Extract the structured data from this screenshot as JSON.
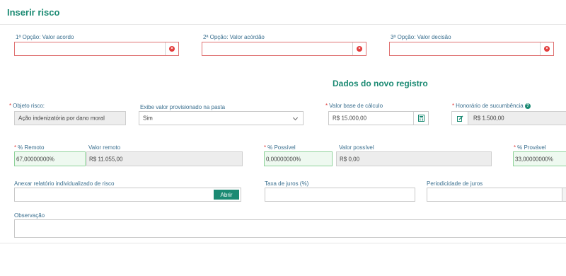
{
  "header": {
    "title": "Inserir risco"
  },
  "options": [
    {
      "label": "1ª Opção: Valor acordo",
      "value": ""
    },
    {
      "label": "2ª Opção: Valor acórdão",
      "value": ""
    },
    {
      "label": "3ª Opção: Valor decisão",
      "value": ""
    }
  ],
  "section_title": "Dados do novo registro",
  "objeto_risco": {
    "label": "Objeto risco:",
    "value": "Ação indenizatória por dano moral"
  },
  "exibe_valor": {
    "label": "Exibe valor provisionado na pasta",
    "value": "Sim"
  },
  "valor_base": {
    "label": "Valor base de cálculo",
    "value": "R$ 15.000,00"
  },
  "honorario": {
    "label": "Honorário de sucumbência",
    "value": "R$ 1.500,00",
    "help": "?"
  },
  "remoto": {
    "pct_label": "% Remoto",
    "pct_value": "67,00000000%",
    "valor_label": "Valor remoto",
    "valor_value": "R$ 11.055,00"
  },
  "possivel": {
    "pct_label": "% Possível",
    "pct_value": "0,00000000%",
    "valor_label": "Valor possível",
    "valor_value": "R$ 0,00"
  },
  "provavel": {
    "pct_label": "% Provável",
    "pct_value": "33,00000000%"
  },
  "anexar": {
    "label": "Anexar relatório individualizado de risco",
    "value": "",
    "button": "Abrir"
  },
  "taxa_juros": {
    "label": "Taxa de juros (%)",
    "value": ""
  },
  "periodicidade": {
    "label": "Periodicidade de juros",
    "value": ""
  },
  "observacao": {
    "label": "Observação",
    "value": ""
  },
  "required_mark": "*",
  "clear_glyph": "×",
  "icons": {
    "clear": "clear-circle-icon",
    "calculator": "calculator-icon",
    "edit": "edit-icon",
    "help": "help-icon",
    "dropdown": "chevron-down-icon"
  },
  "colors": {
    "accent": "#1b8a73",
    "required": "#e03b3b",
    "valid_bg": "#eef9f0"
  }
}
